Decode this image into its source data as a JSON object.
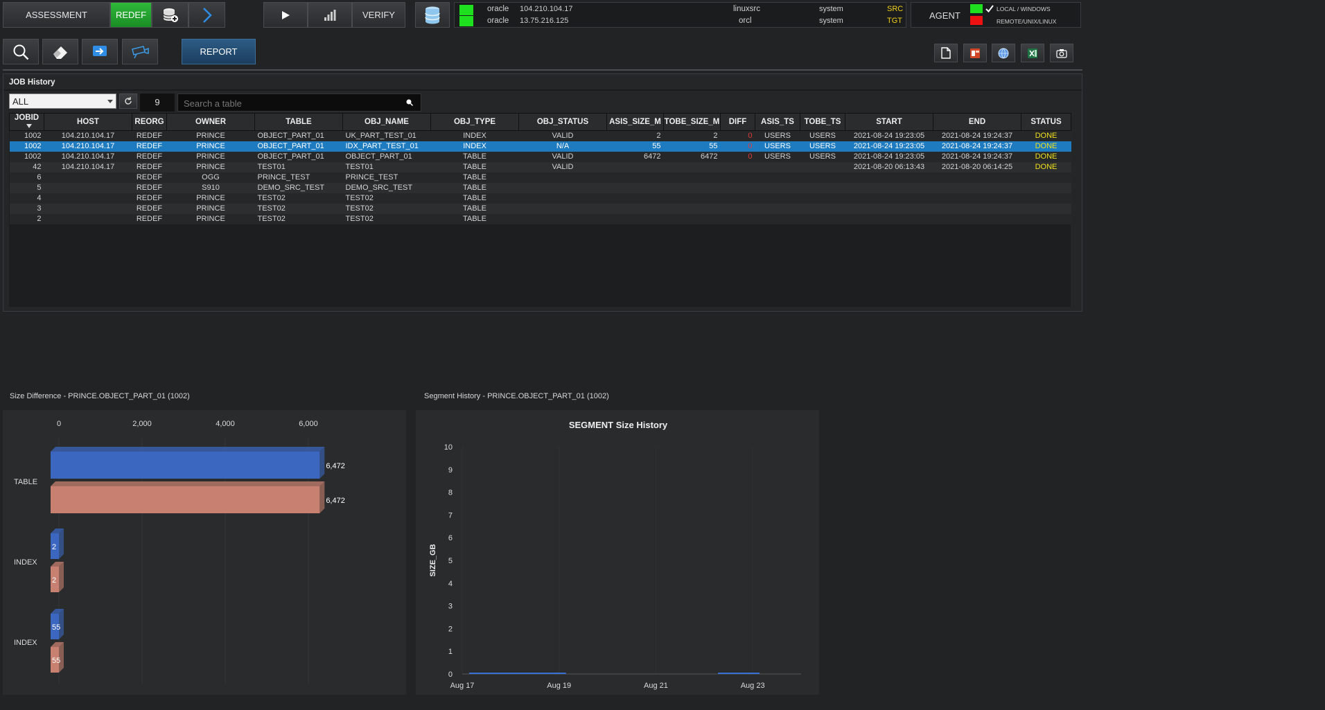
{
  "toolbar": {
    "assessment": "ASSESSMENT",
    "redef": "REDEF",
    "verify": "VERIFY",
    "report": "REPORT",
    "agent": "AGENT"
  },
  "connections": [
    {
      "type": "oracle",
      "ip": "104.210.104.17",
      "db": "linuxsrc",
      "user": "system",
      "role": "SRC",
      "status_color": "#1ee01e"
    },
    {
      "type": "oracle",
      "ip": "13.75.216.125",
      "db": "orcl",
      "user": "system",
      "role": "TGT",
      "status_color": "#1ee01e"
    }
  ],
  "agent": {
    "local_label": "LOCAL / WINDOWS",
    "remote_label": "REMOTE/UNIX/LINUX",
    "local_color": "#1ee01e",
    "remote_color": "#ee1111"
  },
  "job_history": {
    "title": "JOB History",
    "filter_value": "ALL",
    "count": "9",
    "search_placeholder": "Search a table",
    "columns": [
      "JOBID",
      "HOST",
      "REORG",
      "OWNER",
      "TABLE",
      "OBJ_NAME",
      "OBJ_TYPE",
      "OBJ_STATUS",
      "ASIS_SIZE_M",
      "TOBE_SIZE_M",
      "DIFF",
      "ASIS_TS",
      "TOBE_TS",
      "START",
      "END",
      "STATUS"
    ],
    "rows": [
      {
        "jobid": "1002",
        "host": "104.210.104.17",
        "reorg": "REDEF",
        "owner": "PRINCE",
        "table": "OBJECT_PART_01",
        "obj_name": "UK_PART_TEST_01",
        "obj_type": "INDEX",
        "obj_status": "VALID",
        "asis": "2",
        "tobe": "2",
        "diff": "0",
        "asis_ts": "USERS",
        "tobe_ts": "USERS",
        "start": "2021-08-24 19:23:05",
        "end": "2021-08-24 19:24:37",
        "status": "DONE"
      },
      {
        "jobid": "1002",
        "host": "104.210.104.17",
        "reorg": "REDEF",
        "owner": "PRINCE",
        "table": "OBJECT_PART_01",
        "obj_name": "IDX_PART_TEST_01",
        "obj_type": "INDEX",
        "obj_status": "N/A",
        "asis": "55",
        "tobe": "55",
        "diff": "0",
        "asis_ts": "USERS",
        "tobe_ts": "USERS",
        "start": "2021-08-24 19:23:05",
        "end": "2021-08-24 19:24:37",
        "status": "DONE",
        "selected": true
      },
      {
        "jobid": "1002",
        "host": "104.210.104.17",
        "reorg": "REDEF",
        "owner": "PRINCE",
        "table": "OBJECT_PART_01",
        "obj_name": "OBJECT_PART_01",
        "obj_type": "TABLE",
        "obj_status": "VALID",
        "asis": "6472",
        "tobe": "6472",
        "diff": "0",
        "asis_ts": "USERS",
        "tobe_ts": "USERS",
        "start": "2021-08-24 19:23:05",
        "end": "2021-08-24 19:24:37",
        "status": "DONE"
      },
      {
        "jobid": "42",
        "host": "104.210.104.17",
        "reorg": "REDEF",
        "owner": "PRINCE",
        "table": "TEST01",
        "obj_name": "TEST01",
        "obj_type": "TABLE",
        "obj_status": "VALID",
        "asis": "",
        "tobe": "",
        "diff": "",
        "asis_ts": "",
        "tobe_ts": "",
        "start": "2021-08-20 06:13:43",
        "end": "2021-08-20 06:14:25",
        "status": "DONE"
      },
      {
        "jobid": "6",
        "host": "",
        "reorg": "REDEF",
        "owner": "OGG",
        "table": "PRINCE_TEST",
        "obj_name": "PRINCE_TEST",
        "obj_type": "TABLE",
        "obj_status": "",
        "asis": "",
        "tobe": "",
        "diff": "",
        "asis_ts": "",
        "tobe_ts": "",
        "start": "",
        "end": "",
        "status": ""
      },
      {
        "jobid": "5",
        "host": "",
        "reorg": "REDEF",
        "owner": "S910",
        "table": "DEMO_SRC_TEST",
        "obj_name": "DEMO_SRC_TEST",
        "obj_type": "TABLE",
        "obj_status": "",
        "asis": "",
        "tobe": "",
        "diff": "",
        "asis_ts": "",
        "tobe_ts": "",
        "start": "",
        "end": "",
        "status": ""
      },
      {
        "jobid": "4",
        "host": "",
        "reorg": "REDEF",
        "owner": "PRINCE",
        "table": "TEST02",
        "obj_name": "TEST02",
        "obj_type": "TABLE",
        "obj_status": "",
        "asis": "",
        "tobe": "",
        "diff": "",
        "asis_ts": "",
        "tobe_ts": "",
        "start": "",
        "end": "",
        "status": ""
      },
      {
        "jobid": "3",
        "host": "",
        "reorg": "REDEF",
        "owner": "PRINCE",
        "table": "TEST02",
        "obj_name": "TEST02",
        "obj_type": "TABLE",
        "obj_status": "",
        "asis": "",
        "tobe": "",
        "diff": "",
        "asis_ts": "",
        "tobe_ts": "",
        "start": "",
        "end": "",
        "status": ""
      },
      {
        "jobid": "2",
        "host": "",
        "reorg": "REDEF",
        "owner": "PRINCE",
        "table": "TEST02",
        "obj_name": "TEST02",
        "obj_type": "TABLE",
        "obj_status": "",
        "asis": "",
        "tobe": "",
        "diff": "",
        "asis_ts": "",
        "tobe_ts": "",
        "start": "",
        "end": "",
        "status": ""
      }
    ]
  },
  "size_panel_title": "Size Difference - PRINCE.OBJECT_PART_01 (1002)",
  "segment_panel_title": "Segment History - PRINCE.OBJECT_PART_01 (1002)",
  "icons": [
    "search-icon",
    "eraser-icon",
    "arrow-right-box-icon",
    "camera-icon",
    "play-icon",
    "bar-chart-icon",
    "chevron-right-icon",
    "database-icon",
    "database-add-icon",
    "document-icon",
    "powerpoint-icon",
    "globe-icon",
    "excel-icon",
    "screenshot-icon",
    "refresh-icon",
    "dropdown-arrow-icon",
    "sort-down-icon",
    "checkmark-icon"
  ],
  "chart_data": [
    {
      "type": "bar",
      "orientation": "horizontal",
      "categories": [
        "TABLE",
        "INDEX",
        "INDEX"
      ],
      "series": [
        {
          "values": [
            6472,
            2,
            55
          ],
          "color": "#3c67c0"
        },
        {
          "values": [
            6472,
            2,
            55
          ],
          "color": "#c88070"
        }
      ],
      "xticks": [
        "0",
        "2,000",
        "4,000",
        "6,000"
      ],
      "xlim": [
        0,
        8000
      ],
      "data_labels": [
        "6,472",
        "6,472",
        "2",
        "2",
        "55",
        "55"
      ]
    },
    {
      "type": "line",
      "title": "SEGMENT Size History",
      "ylabel": "SIZE_GB",
      "ylim": [
        0,
        10
      ],
      "yticks": [
        "0",
        "1",
        "2",
        "3",
        "4",
        "5",
        "6",
        "7",
        "8",
        "9",
        "10"
      ],
      "xticks": [
        "Aug 17",
        "Aug 19",
        "Aug 21",
        "Aug 23"
      ],
      "x": [
        "Aug 17",
        "Aug 19",
        "Aug 23"
      ],
      "values": [
        0,
        0,
        0
      ],
      "color": "#3a6fd8"
    }
  ]
}
